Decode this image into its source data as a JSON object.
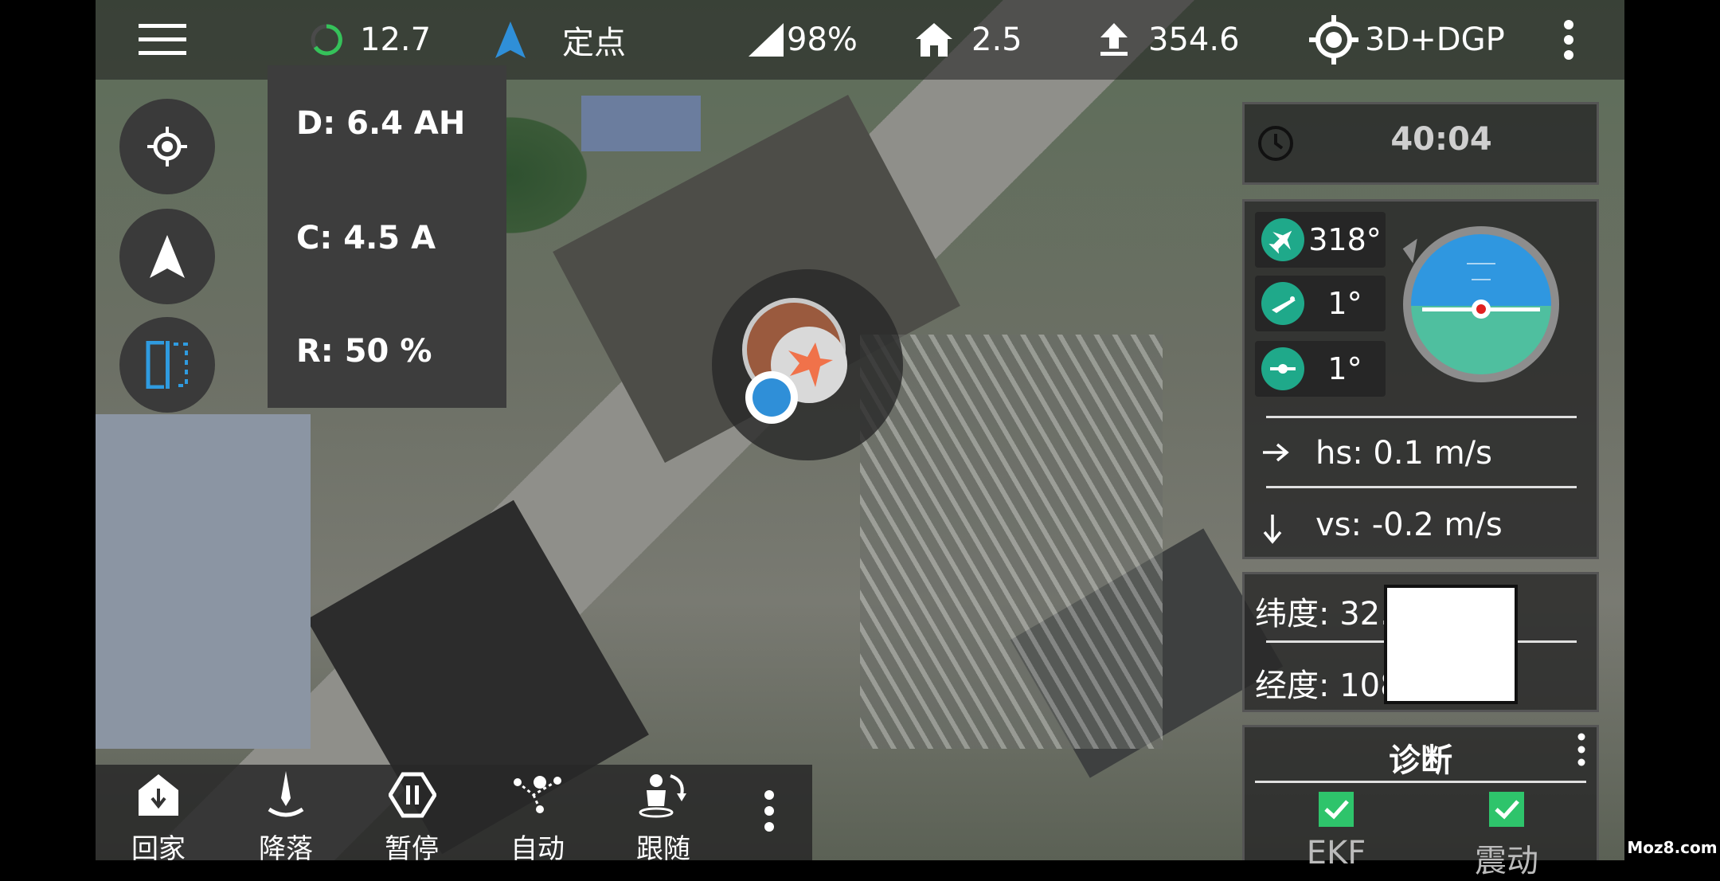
{
  "topbar": {
    "battery_voltage": "12.7",
    "flight_mode": "定点",
    "signal_strength": "98%",
    "home_distance": "2.5",
    "altitude": "354.6",
    "gps_fix": "3D+DGP"
  },
  "battery_panel": {
    "discharged": "D: 6.4 AH",
    "current": "C: 4.5 A",
    "remaining": "R: 50 %"
  },
  "telemetry": {
    "flight_time": "40:04",
    "heading": "318°",
    "pitch": "1°",
    "roll": "1°",
    "horizontal_speed": "hs: 0.1 m/s",
    "vertical_speed": "vs: -0.2 m/s",
    "latitude": "纬度: 32.",
    "longitude": "经度: 108"
  },
  "diagnostics": {
    "title": "诊断",
    "items": [
      "EKF",
      "震动"
    ]
  },
  "bottom_actions": [
    {
      "label": "回家",
      "icon": "home-return-icon"
    },
    {
      "label": "降落",
      "icon": "land-icon"
    },
    {
      "label": "暂停",
      "icon": "pause-icon"
    },
    {
      "label": "自动",
      "icon": "auto-mission-icon"
    },
    {
      "label": "跟随",
      "icon": "follow-icon"
    }
  ],
  "watermark": "Moz8.com",
  "colors": {
    "accent_teal": "#1fa98a",
    "accent_blue": "#2f8fd8",
    "drone_orange": "#f0724a",
    "check_green": "#2ec46b"
  }
}
